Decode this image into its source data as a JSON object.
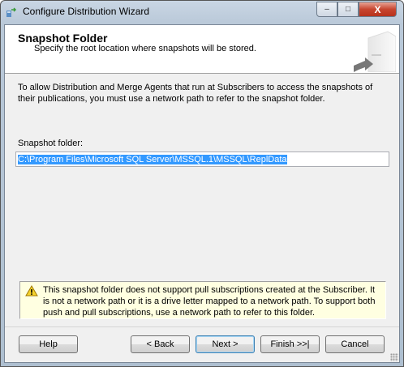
{
  "window": {
    "title": "Configure Distribution Wizard",
    "minimize": "–",
    "maximize": "□",
    "close": "X"
  },
  "header": {
    "title": "Snapshot Folder",
    "subtitle": "Specify the root location where snapshots will be stored."
  },
  "body": {
    "intro": "To allow Distribution and Merge Agents that run at Subscribers to access the snapshots of their publications, you must use a network path to refer to the snapshot folder.",
    "snapshot_label": "Snapshot folder:",
    "snapshot_value": "C:\\Program Files\\Microsoft SQL Server\\MSSQL.1\\MSSQL\\ReplData",
    "warning": "This snapshot folder does not support pull subscriptions created at the Subscriber. It is not a network path or it is a drive letter mapped to a network path. To support both push and pull subscriptions, use a network path to refer to this folder."
  },
  "buttons": {
    "help": "Help",
    "back": "< Back",
    "next": "Next >",
    "finish": "Finish >>|",
    "cancel": "Cancel"
  }
}
